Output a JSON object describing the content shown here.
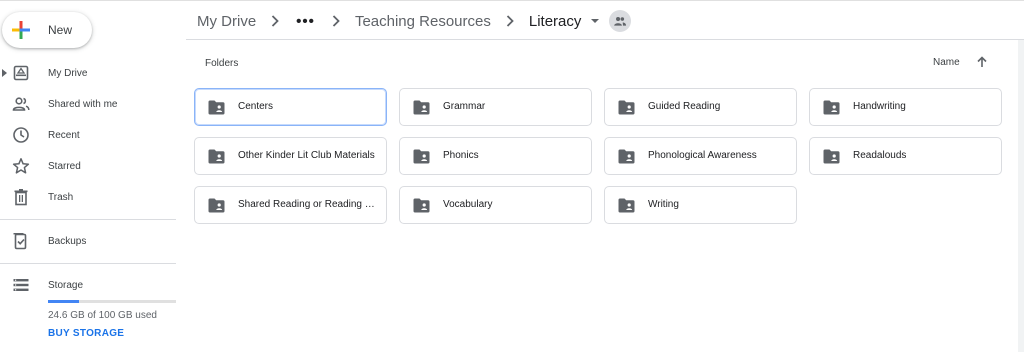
{
  "sidebar": {
    "new_label": "New",
    "items": [
      {
        "label": "My Drive",
        "icon": "my-drive-icon"
      },
      {
        "label": "Shared with me",
        "icon": "shared-people-icon"
      },
      {
        "label": "Recent",
        "icon": "clock-icon"
      },
      {
        "label": "Starred",
        "icon": "star-icon"
      },
      {
        "label": "Trash",
        "icon": "trash-icon"
      },
      {
        "label": "Backups",
        "icon": "backup-icon"
      },
      {
        "label": "Storage",
        "icon": "storage-icon"
      }
    ],
    "storage": {
      "used_text": "24.6 GB of 100 GB used",
      "used_fraction": 0.246,
      "buy_label": "BUY STORAGE"
    }
  },
  "breadcrumb": {
    "root": "My Drive",
    "more": "•••",
    "parent": "Teaching Resources",
    "current": "Literacy"
  },
  "main": {
    "section_title": "Folders",
    "sort_label": "Name",
    "sort_direction": "ascending",
    "folders": [
      {
        "name": "Centers",
        "selected": true
      },
      {
        "name": "Grammar"
      },
      {
        "name": "Guided Reading"
      },
      {
        "name": "Handwriting"
      },
      {
        "name": "Other Kinder Lit Club Materials"
      },
      {
        "name": "Phonics"
      },
      {
        "name": "Phonological Awareness"
      },
      {
        "name": "Readalouds"
      },
      {
        "name": "Shared Reading or Reading W..."
      },
      {
        "name": "Vocabulary"
      },
      {
        "name": "Writing"
      }
    ]
  },
  "colors": {
    "accent": "#1a73e8",
    "storage_bar": "#4285f4",
    "selected_border": "#8ab4f8",
    "icon": "#5f6368"
  }
}
